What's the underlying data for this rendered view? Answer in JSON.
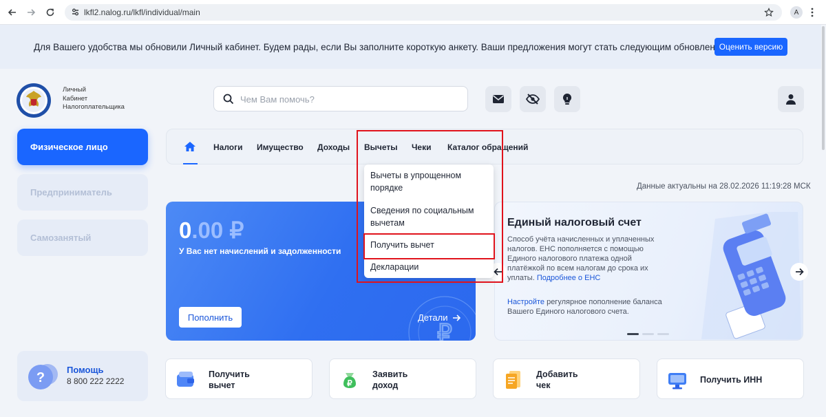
{
  "browser": {
    "url": "lkfl2.nalog.ru/lkfl/individual/main",
    "avatar_letter": "A"
  },
  "banner": {
    "text": "Для Вашего удобства мы обновили Личный кабинет. Будем рады, если Вы заполните короткую анкету. Ваши предложения могут стать следующим обновлением",
    "button": "Оценить версию"
  },
  "header": {
    "logo_line1": "Личный",
    "logo_line2": "Кабинет",
    "logo_line3": "Налогоплательщика",
    "search_placeholder": "Чем Вам помочь?"
  },
  "sidebar": {
    "items": [
      {
        "label": "Физическое лицо"
      },
      {
        "label": "Предприниматель"
      },
      {
        "label": "Самозанятый"
      }
    ],
    "help_title": "Помощь",
    "help_phone": "8 800 222 2222"
  },
  "tabs": {
    "items": [
      {
        "label": "Налоги"
      },
      {
        "label": "Имущество"
      },
      {
        "label": "Доходы"
      },
      {
        "label": "Вычеты"
      },
      {
        "label": "Чеки"
      },
      {
        "label": "Каталог обращений"
      }
    ]
  },
  "dropdown": {
    "items": [
      {
        "label": "Вычеты в упрощенном порядке"
      },
      {
        "label": "Сведения по социальным вычетам"
      },
      {
        "label": "Получить вычет"
      },
      {
        "label": "Декларации"
      }
    ]
  },
  "data_actual": "Данные актуальны на 28.02.2026 11:19:28 МСК",
  "balance": {
    "amount_int": "0",
    "amount_dec": ".00 ₽",
    "subtitle": "У Вас нет начислений и задолженности",
    "topup": "Пополнить",
    "details": "Детали"
  },
  "ens": {
    "title": "Единый налоговый счет",
    "desc": "Способ учёта начисленных и уплаченных налогов. ЕНС пополняется с помощью Единого налогового платежа одной платёжкой по всем налогам до срока их уплаты.",
    "desc_link": "Подробнее о ЕНС",
    "desc2_link": "Настройте",
    "desc2": " регулярное пополнение баланса Вашего Единого налогового счета."
  },
  "quick_actions": [
    {
      "line1": "Получить",
      "line2": "вычет"
    },
    {
      "line1": "Заявить",
      "line2": "доход"
    },
    {
      "line1": "Добавить",
      "line2": "чек"
    },
    {
      "line1": "Получить ИНН",
      "line2": ""
    }
  ],
  "colors": {
    "accent": "#1a66ff",
    "highlight": "#e0121b"
  }
}
